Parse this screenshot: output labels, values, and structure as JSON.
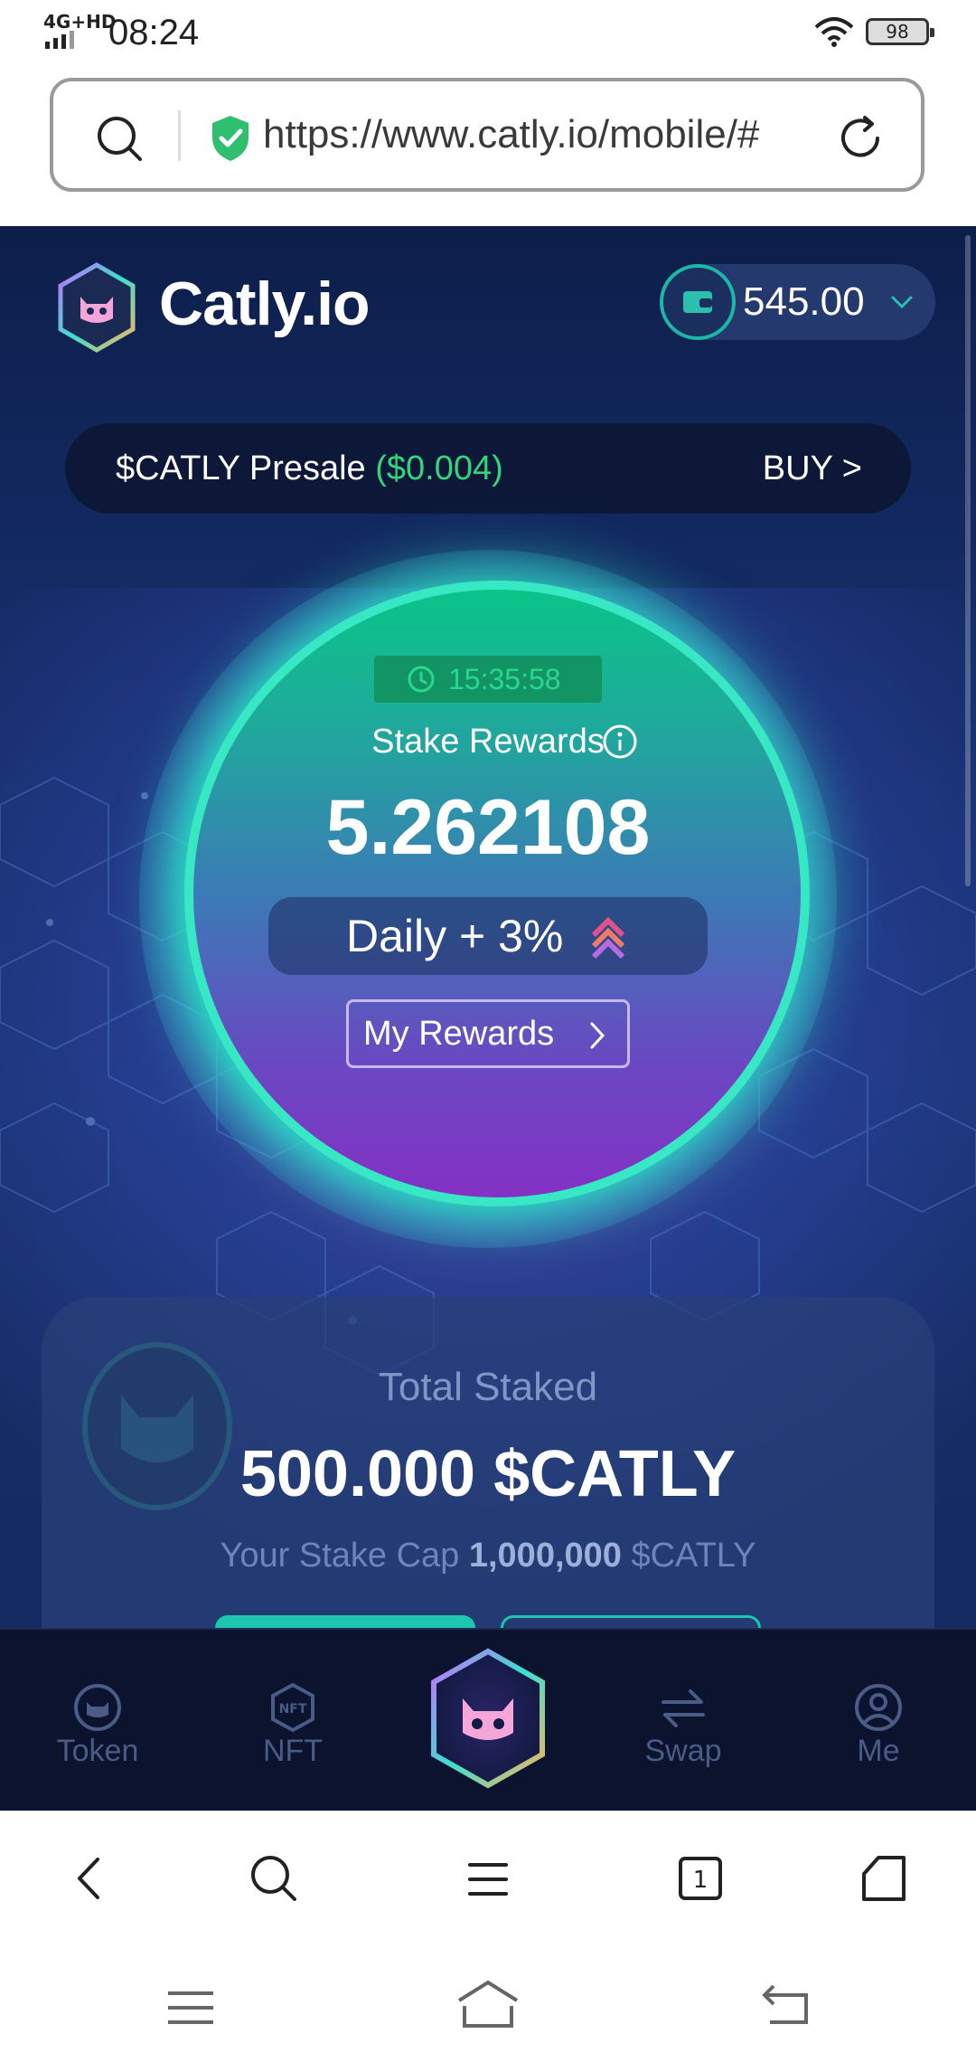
{
  "status_bar": {
    "network": "4G+HD",
    "time": "08:24",
    "battery": "98"
  },
  "browser": {
    "url": "https://www.catly.io/mobile/#"
  },
  "header": {
    "brand": "Catly.io",
    "wallet_balance": "545.00"
  },
  "presale": {
    "label": "$CATLY Presale",
    "price": "($0.004)",
    "buy_label": "BUY >"
  },
  "stake": {
    "timer": "15:35:58",
    "label": "Stake Rewards",
    "value": "5.262108",
    "daily": "Daily + 3%",
    "my_rewards": "My Rewards"
  },
  "staked_card": {
    "label": "Total Staked",
    "value": "500.000 $CATLY",
    "cap_prefix": "Your Stake Cap",
    "cap_value": "1,000,000",
    "cap_suffix": "$CATLY"
  },
  "bottom_nav": [
    {
      "label": "Token",
      "icon": "token-icon"
    },
    {
      "label": "NFT",
      "icon": "nft-icon"
    },
    {
      "label": "",
      "icon": "catly-center-icon"
    },
    {
      "label": "Swap",
      "icon": "swap-icon"
    },
    {
      "label": "Me",
      "icon": "profile-icon"
    }
  ],
  "colors": {
    "accent_teal": "#1cc6b0",
    "price_green": "#35d47c",
    "app_bg": "#142c66",
    "nav_bg": "#0b132e"
  }
}
